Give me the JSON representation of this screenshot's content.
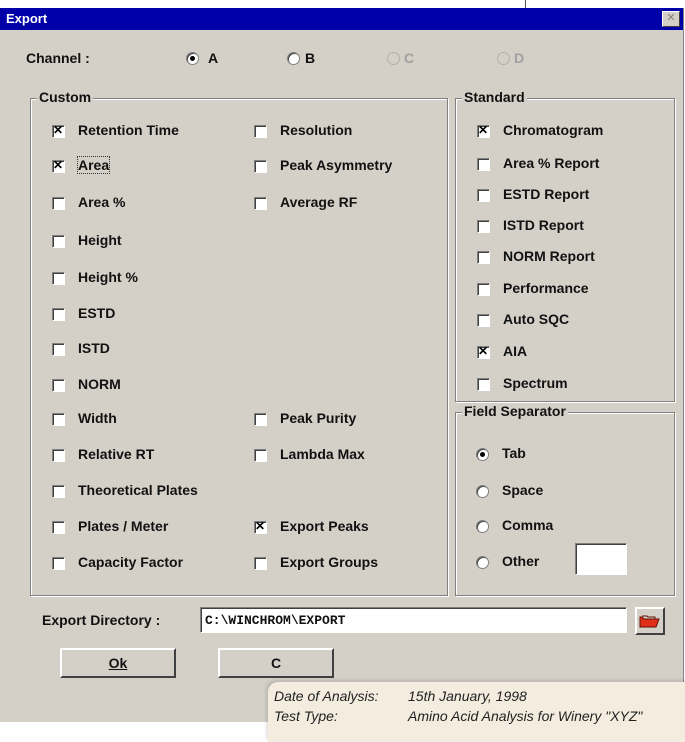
{
  "window": {
    "title": "Export",
    "close_glyph": "✕"
  },
  "channel": {
    "label": "Channel :",
    "options": [
      {
        "label": "A",
        "selected": true,
        "enabled": true
      },
      {
        "label": "B",
        "selected": false,
        "enabled": true
      },
      {
        "label": "C",
        "selected": false,
        "enabled": false
      },
      {
        "label": "D",
        "selected": false,
        "enabled": false
      }
    ]
  },
  "custom": {
    "legend": "Custom",
    "items": [
      {
        "label": "Retention Time",
        "checked": true
      },
      {
        "label": "Area",
        "checked": true
      },
      {
        "label": "Area %",
        "checked": false
      },
      {
        "label": "Height",
        "checked": false
      },
      {
        "label": "Height %",
        "checked": false
      },
      {
        "label": "ESTD",
        "checked": false
      },
      {
        "label": "ISTD",
        "checked": false
      },
      {
        "label": "NORM",
        "checked": false
      },
      {
        "label": "Width",
        "checked": false
      },
      {
        "label": "Relative RT",
        "checked": false
      },
      {
        "label": "Theoretical Plates",
        "checked": false
      },
      {
        "label": "Plates / Meter",
        "checked": false
      },
      {
        "label": "Capacity Factor",
        "checked": false
      },
      {
        "label": "Resolution",
        "checked": false
      },
      {
        "label": "Peak Asymmetry",
        "checked": false
      },
      {
        "label": "Average RF",
        "checked": false
      },
      {
        "label": "Peak Purity",
        "checked": false
      },
      {
        "label": "Lambda Max",
        "checked": false
      },
      {
        "label": "Export Peaks",
        "checked": true
      },
      {
        "label": "Export Groups",
        "checked": false
      }
    ]
  },
  "standard": {
    "legend": "Standard",
    "items": [
      {
        "label": "Chromatogram",
        "checked": true
      },
      {
        "label": "Area % Report",
        "checked": false
      },
      {
        "label": "ESTD Report",
        "checked": false
      },
      {
        "label": "ISTD Report",
        "checked": false
      },
      {
        "label": "NORM Report",
        "checked": false
      },
      {
        "label": "Performance",
        "checked": false
      },
      {
        "label": "Auto SQC",
        "checked": false
      },
      {
        "label": "AIA",
        "checked": true
      },
      {
        "label": "Spectrum",
        "checked": false
      }
    ]
  },
  "separator": {
    "legend": "Field Separator",
    "options": [
      {
        "label": "Tab",
        "selected": true
      },
      {
        "label": "Space",
        "selected": false
      },
      {
        "label": "Comma",
        "selected": false
      },
      {
        "label": "Other",
        "selected": false
      }
    ],
    "other_value": ""
  },
  "export_dir": {
    "label": "Export Directory :",
    "value": "C:\\WINCHROM\\EXPORT",
    "browse_icon": "folder-icon"
  },
  "buttons": {
    "ok": "Ok",
    "cancel_partial": "C"
  },
  "note": {
    "date_label": "Date of Analysis:",
    "date_value": "15th January, 1998",
    "test_label": "Test Type:",
    "test_value": "Amino Acid Analysis for Winery \"XYZ\""
  },
  "colors": {
    "title_bar": "#0000a8",
    "dialog": "#d4d0c8",
    "folder_icon": "#e03018"
  }
}
